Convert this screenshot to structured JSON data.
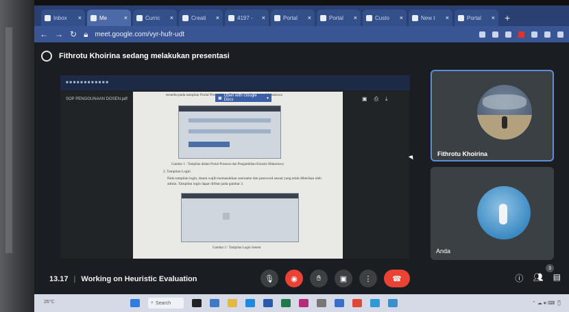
{
  "browser": {
    "tabs": [
      {
        "label": "Inbox",
        "active": false
      },
      {
        "label": "Me",
        "active": true
      },
      {
        "label": "Curric",
        "active": false
      },
      {
        "label": "Creati",
        "active": false
      },
      {
        "label": "4197 -",
        "active": false
      },
      {
        "label": "Portal",
        "active": false
      },
      {
        "label": "Portal",
        "active": false
      },
      {
        "label": "Custo",
        "active": false
      },
      {
        "label": "New t",
        "active": false
      },
      {
        "label": "Portal",
        "active": false
      }
    ],
    "new_tab": "+",
    "url": "meet.google.com/vyr-hufr-udt"
  },
  "meet": {
    "presenting_banner": "Fithrotu Khoirina sedang melakukan presentasi",
    "shared_screen": {
      "file_name": "SOP PENGGUNAAN DOSEN.pdf",
      "open_with_button": "Open with Google Docs",
      "doc": {
        "para_top": "tersedia pada tampilan Portal Presensi dan Pengambilan Kuesioner Mahasiswa",
        "caption_1": "Gambar 1 : Tampilan dalam Portal Presensi dan Pengambilan Kuisoin Mahasiswa",
        "section_heading": "2.  Tampilan Login",
        "para_login": "Pada tampilan login, dosen wajib memasukkan username dan password sesuai yang telah diberikan oleh admin. Tampilan login dapat dilihat pada gambar 2.",
        "caption_2": "Gambar 2 : Tampilan Login Sistem"
      }
    },
    "participants": [
      {
        "name": "Fithrotu Khoirina"
      },
      {
        "name": "Anda"
      }
    ],
    "time": "13.17",
    "separator": "|",
    "meeting_title": "Working on Heuristic Evaluation",
    "people_count": "3"
  },
  "taskbar": {
    "search_label": "Search",
    "weather": "26°C"
  },
  "colors": {
    "accent_blue": "#3b5ea6",
    "end_call_red": "#ea4335",
    "meet_bg": "#1a1d21"
  }
}
